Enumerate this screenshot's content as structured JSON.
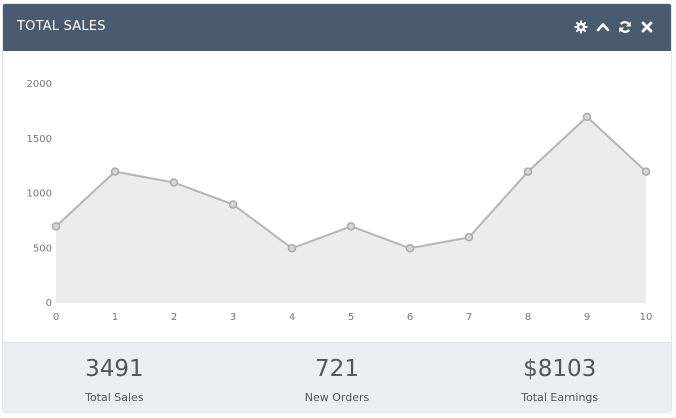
{
  "widget": {
    "title": "TOTAL SALES",
    "tools": [
      {
        "name": "gear-icon"
      },
      {
        "name": "chevron-up-icon"
      },
      {
        "name": "refresh-icon"
      },
      {
        "name": "close-icon"
      }
    ]
  },
  "chart_data": {
    "type": "area",
    "x": [
      0,
      1,
      2,
      3,
      4,
      5,
      6,
      7,
      8,
      9,
      10
    ],
    "series": [
      {
        "values": [
          700,
          1200,
          1100,
          900,
          500,
          700,
          500,
          600,
          1200,
          1700,
          1200
        ]
      }
    ],
    "xticks": [
      "0",
      "1",
      "2",
      "3",
      "4",
      "5",
      "6",
      "7",
      "8",
      "9",
      "10"
    ],
    "yticks": [
      "0",
      "500",
      "1000",
      "1500",
      "2000"
    ],
    "ylim": [
      0,
      2000
    ],
    "xlim": [
      0,
      10
    ],
    "grid": false,
    "line_color": "#b5b5b5",
    "fill_color": "#ececec"
  },
  "stats": [
    {
      "value": "3491",
      "label": "Total Sales"
    },
    {
      "value": "721",
      "label": "New Orders"
    },
    {
      "value": "$8103",
      "label": "Total Earnings"
    }
  ],
  "colors": {
    "header_bg": "#4a5b70",
    "footer_bg": "#eceef1"
  }
}
